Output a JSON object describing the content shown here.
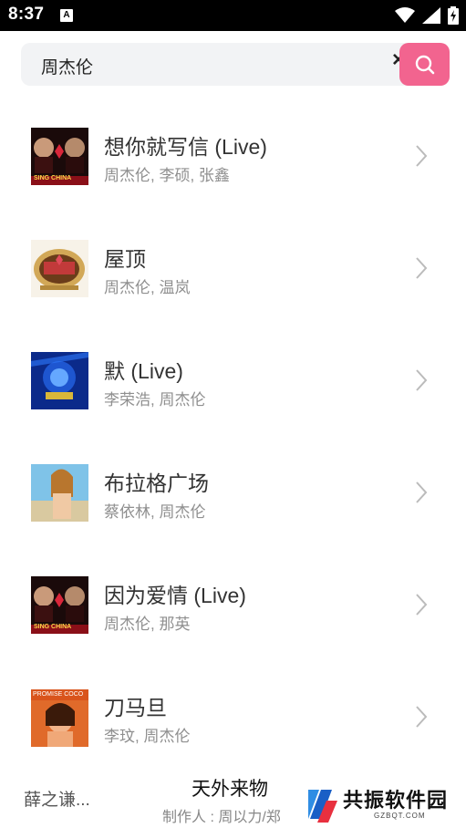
{
  "status_bar": {
    "time": "8:37",
    "notification_icon_letter": "A",
    "icons": [
      "wifi-icon",
      "signal-icon",
      "battery-charging-icon"
    ]
  },
  "search": {
    "query": "周杰伦",
    "clear_icon": "close-icon",
    "search_icon": "search-icon",
    "accent_color": "#f2648f"
  },
  "songs": [
    {
      "title": "想你就写信 (Live)",
      "artists": "周杰伦, 李硕, 张鑫",
      "cover": "singchina-cover"
    },
    {
      "title": "屋顶",
      "artists": "周杰伦, 温岚",
      "cover": "golden-badge-cover"
    },
    {
      "title": "默 (Live)",
      "artists": "李荣浩, 周杰伦",
      "cover": "blue-logo-cover"
    },
    {
      "title": "布拉格广场",
      "artists": "蔡依林, 周杰伦",
      "cover": "portrait-cover"
    },
    {
      "title": "因为爱情 (Live)",
      "artists": "周杰伦, 那英",
      "cover": "singchina-cover"
    },
    {
      "title": "刀马旦",
      "artists": "李玟, 周杰伦",
      "cover": "promise-coco-cover"
    }
  ],
  "cover_texts": {
    "singchina": "SING CHINA",
    "promise": "PROMISE COCO"
  },
  "player": {
    "left_label": "薛之谦...",
    "title": "天外来物",
    "subtitle": "制作人 : 周以力/郑"
  },
  "watermark": {
    "text": "共振软件园",
    "sub": "GZBQT.COM"
  }
}
